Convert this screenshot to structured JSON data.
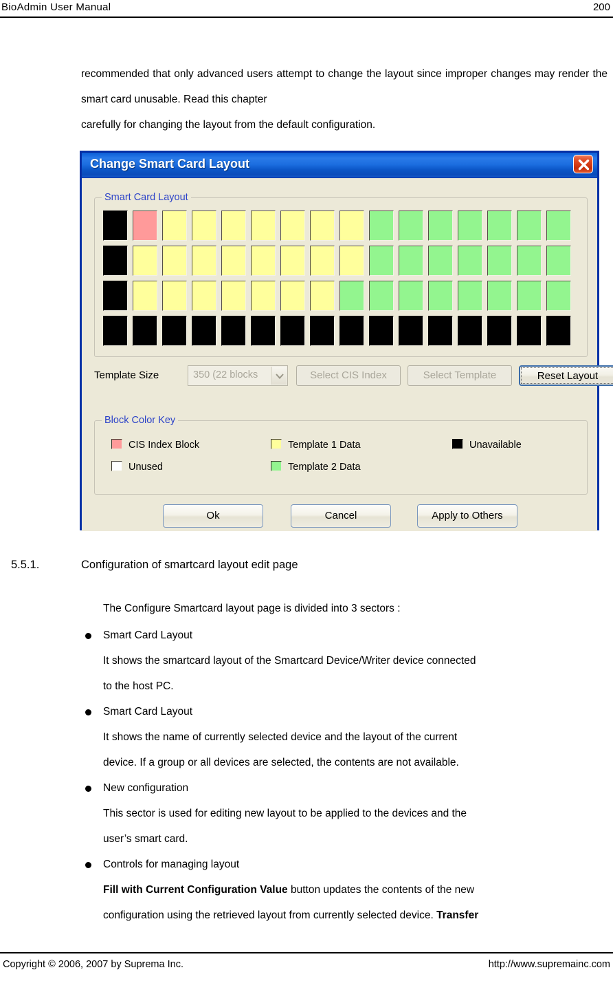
{
  "header": {
    "title": "BioAdmin  User  Manual",
    "page_number": "200"
  },
  "intro_paragraph": {
    "line1": "recommended that only advanced users attempt to change the layout since improper changes may render the smart card unusable. Read this chapter",
    "line2": "carefully for changing the layout from the default configuration."
  },
  "dialog": {
    "title": "Change Smart Card Layout",
    "close_icon": "close-icon",
    "layout_group": {
      "title": "Smart Card Layout",
      "grid": {
        "columns": 16,
        "rows": [
          [
            "unavailable",
            "cis",
            "t1",
            "t1",
            "t1",
            "t1",
            "t1",
            "t1",
            "t1",
            "t2",
            "t2",
            "t2",
            "t2",
            "t2",
            "t2",
            "t2"
          ],
          [
            "unavailable",
            "t1",
            "t1",
            "t1",
            "t1",
            "t1",
            "t1",
            "t1",
            "t1",
            "t2",
            "t2",
            "t2",
            "t2",
            "t2",
            "t2",
            "t2"
          ],
          [
            "unavailable",
            "t1",
            "t1",
            "t1",
            "t1",
            "t1",
            "t1",
            "t1",
            "t2",
            "t2",
            "t2",
            "t2",
            "t2",
            "t2",
            "t2",
            "t2"
          ],
          [
            "unavailable",
            "unavailable",
            "unavailable",
            "unavailable",
            "unavailable",
            "unavailable",
            "unavailable",
            "unavailable",
            "unavailable",
            "unavailable",
            "unavailable",
            "unavailable",
            "unavailable",
            "unavailable",
            "unavailable",
            "unavailable"
          ]
        ]
      }
    },
    "template_size": {
      "label": "Template Size",
      "combo_value": "350 (22 blocks",
      "select_cis_index": "Select CIS Index",
      "select_template": "Select Template",
      "reset_layout": "Reset Layout"
    },
    "color_key": {
      "title": "Block Color Key",
      "items": [
        {
          "swatch": "cis",
          "label": "CIS Index Block"
        },
        {
          "swatch": "t1",
          "label": "Template 1 Data"
        },
        {
          "swatch": "unavailable",
          "label": "Unavailable"
        },
        {
          "swatch": "unused",
          "label": "Unused"
        },
        {
          "swatch": "t2",
          "label": "Template 2 Data"
        }
      ]
    },
    "buttons": {
      "ok": "Ok",
      "cancel": "Cancel",
      "apply_to_others": "Apply to Others"
    },
    "colors": {
      "titlebar_blue": "#1668de",
      "border_blue": "#0531a6",
      "face": "#ece9d8",
      "group_title_blue": "#2b42c8",
      "cis_pink": "#ff9a9a",
      "template1_yellow": "#ffff9c",
      "template2_green": "#93f58f",
      "unavailable_black": "#000000",
      "unused_white": "#ffffff",
      "close_red": "#c62d09"
    }
  },
  "section": {
    "number": "5.5.1.",
    "title": "Configuration of smartcard layout edit page",
    "lead": "The Configure Smartcard layout page is divided into 3 sectors :",
    "items": [
      {
        "bullet": "Smart Card Layout",
        "body_line1": "It shows the smartcard layout of the Smartcard Device/Writer device connected",
        "body_line2": "to the host PC."
      },
      {
        "bullet": "Smart Card Layout",
        "body_line1": "It shows the name of currently selected device and the layout of the current",
        "body_line2": "device. If a group or all devices are selected, the contents are not available."
      },
      {
        "bullet": "New configuration",
        "body_line1": "This sector is used for editing new layout to be applied to the devices and the",
        "body_line2": "user’s smart card."
      },
      {
        "bullet": "Controls for managing layout",
        "body_bold1": "Fill with Current Configuration Value",
        "body_mid1": " button updates the contents of the new",
        "body_line2": "configuration using the retrieved layout from currently selected device. ",
        "body_bold2": "Transfer"
      }
    ]
  },
  "footer": {
    "left": "Copyright © 2006, 2007 by Suprema Inc.",
    "right": "http://www.supremainc.com"
  }
}
